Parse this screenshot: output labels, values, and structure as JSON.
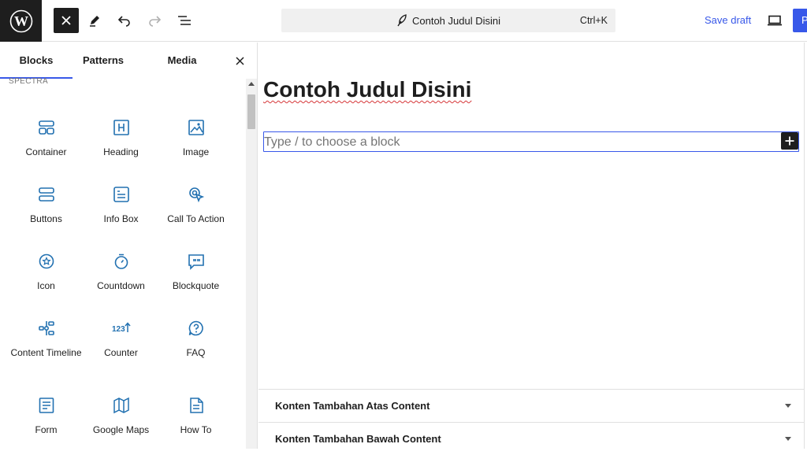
{
  "toolbar": {
    "logo_icon": "wordpress-logo-icon",
    "close_inserter_icon": "close-icon",
    "tools_icon": "pencil-icon",
    "undo_icon": "undo-icon",
    "redo_icon": "redo-icon",
    "list_view_icon": "list-view-icon",
    "document_title": "Contoh Judul Disini",
    "shortcut": "Ctrl+K",
    "save_draft": "Save draft",
    "preview_icon": "desktop-icon",
    "publish_partial": "P"
  },
  "inserter": {
    "tabs": [
      {
        "label": "Blocks",
        "active": true
      },
      {
        "label": "Patterns",
        "active": false
      },
      {
        "label": "Media",
        "active": false
      }
    ],
    "category": "SPECTRA",
    "blocks": [
      {
        "label": "Container",
        "icon": "container-icon"
      },
      {
        "label": "Heading",
        "icon": "heading-icon"
      },
      {
        "label": "Image",
        "icon": "image-icon"
      },
      {
        "label": "Buttons",
        "icon": "buttons-icon"
      },
      {
        "label": "Info Box",
        "icon": "info-box-icon"
      },
      {
        "label": "Call To Action",
        "icon": "call-to-action-icon"
      },
      {
        "label": "Icon",
        "icon": "icon-block-icon"
      },
      {
        "label": "Countdown",
        "icon": "countdown-icon"
      },
      {
        "label": "Blockquote",
        "icon": "blockquote-icon"
      },
      {
        "label": "Content Timeline",
        "icon": "timeline-icon"
      },
      {
        "label": "Counter",
        "icon": "counter-icon"
      },
      {
        "label": "FAQ",
        "icon": "faq-icon"
      },
      {
        "label": "Form",
        "icon": "form-icon"
      },
      {
        "label": "Google Maps",
        "icon": "map-icon"
      },
      {
        "label": "How To",
        "icon": "how-to-icon"
      }
    ]
  },
  "editor": {
    "post_title": "Contoh Judul Disini",
    "block_placeholder": "Type / to choose a block"
  },
  "metaboxes": [
    {
      "title": "Konten Tambahan Atas Content"
    },
    {
      "title": "Konten Tambahan Bawah Content"
    }
  ],
  "colors": {
    "accent": "#3858e9",
    "dark": "#1e1e1e",
    "spellcheck": "#d63638"
  }
}
